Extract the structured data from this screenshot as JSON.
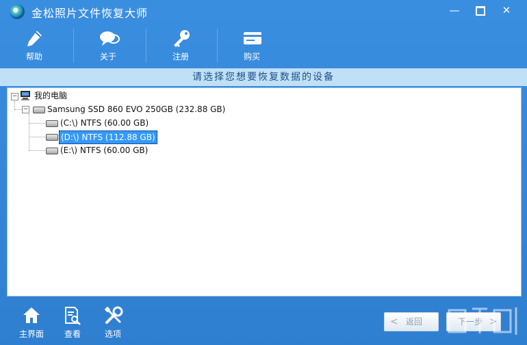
{
  "window": {
    "title": "金松照片文件恢复大师",
    "controls": {
      "minimize": "—",
      "maximize": "",
      "close": "✕"
    }
  },
  "toolbar": {
    "items": [
      {
        "label": "帮助",
        "icon": "pencil-icon"
      },
      {
        "label": "关于",
        "icon": "chat-bubbles-icon"
      },
      {
        "label": "注册",
        "icon": "key-icon"
      },
      {
        "label": "购买",
        "icon": "credit-card-icon"
      }
    ]
  },
  "header": {
    "text": "请选择您想要恢复数据的设备"
  },
  "tree": {
    "root": {
      "label": "我的电脑",
      "expander": "−"
    },
    "disk": {
      "label": "Samsung SSD 860 EVO 250GB (232.88 GB)",
      "expander": "−"
    },
    "partitions": [
      {
        "label": "(C:\\) NTFS (60.00 GB)",
        "selected": false
      },
      {
        "label": "(D:\\) NTFS (112.88 GB)",
        "selected": true
      },
      {
        "label": "(E:\\) NTFS (60.00 GB)",
        "selected": false
      }
    ]
  },
  "bottom": {
    "home": {
      "label": "主界面",
      "icon": "home-icon"
    },
    "view": {
      "label": "查看",
      "icon": "document-search-icon"
    },
    "options": {
      "label": "选项",
      "icon": "tools-icon"
    },
    "back": {
      "label": "返回",
      "chevron": "<"
    },
    "next": {
      "label": "下一步",
      "chevron": ">"
    }
  },
  "colors": {
    "accent": "#3a8ee0",
    "header_bg": "#bfe0f6",
    "selection": "#3399ff"
  }
}
